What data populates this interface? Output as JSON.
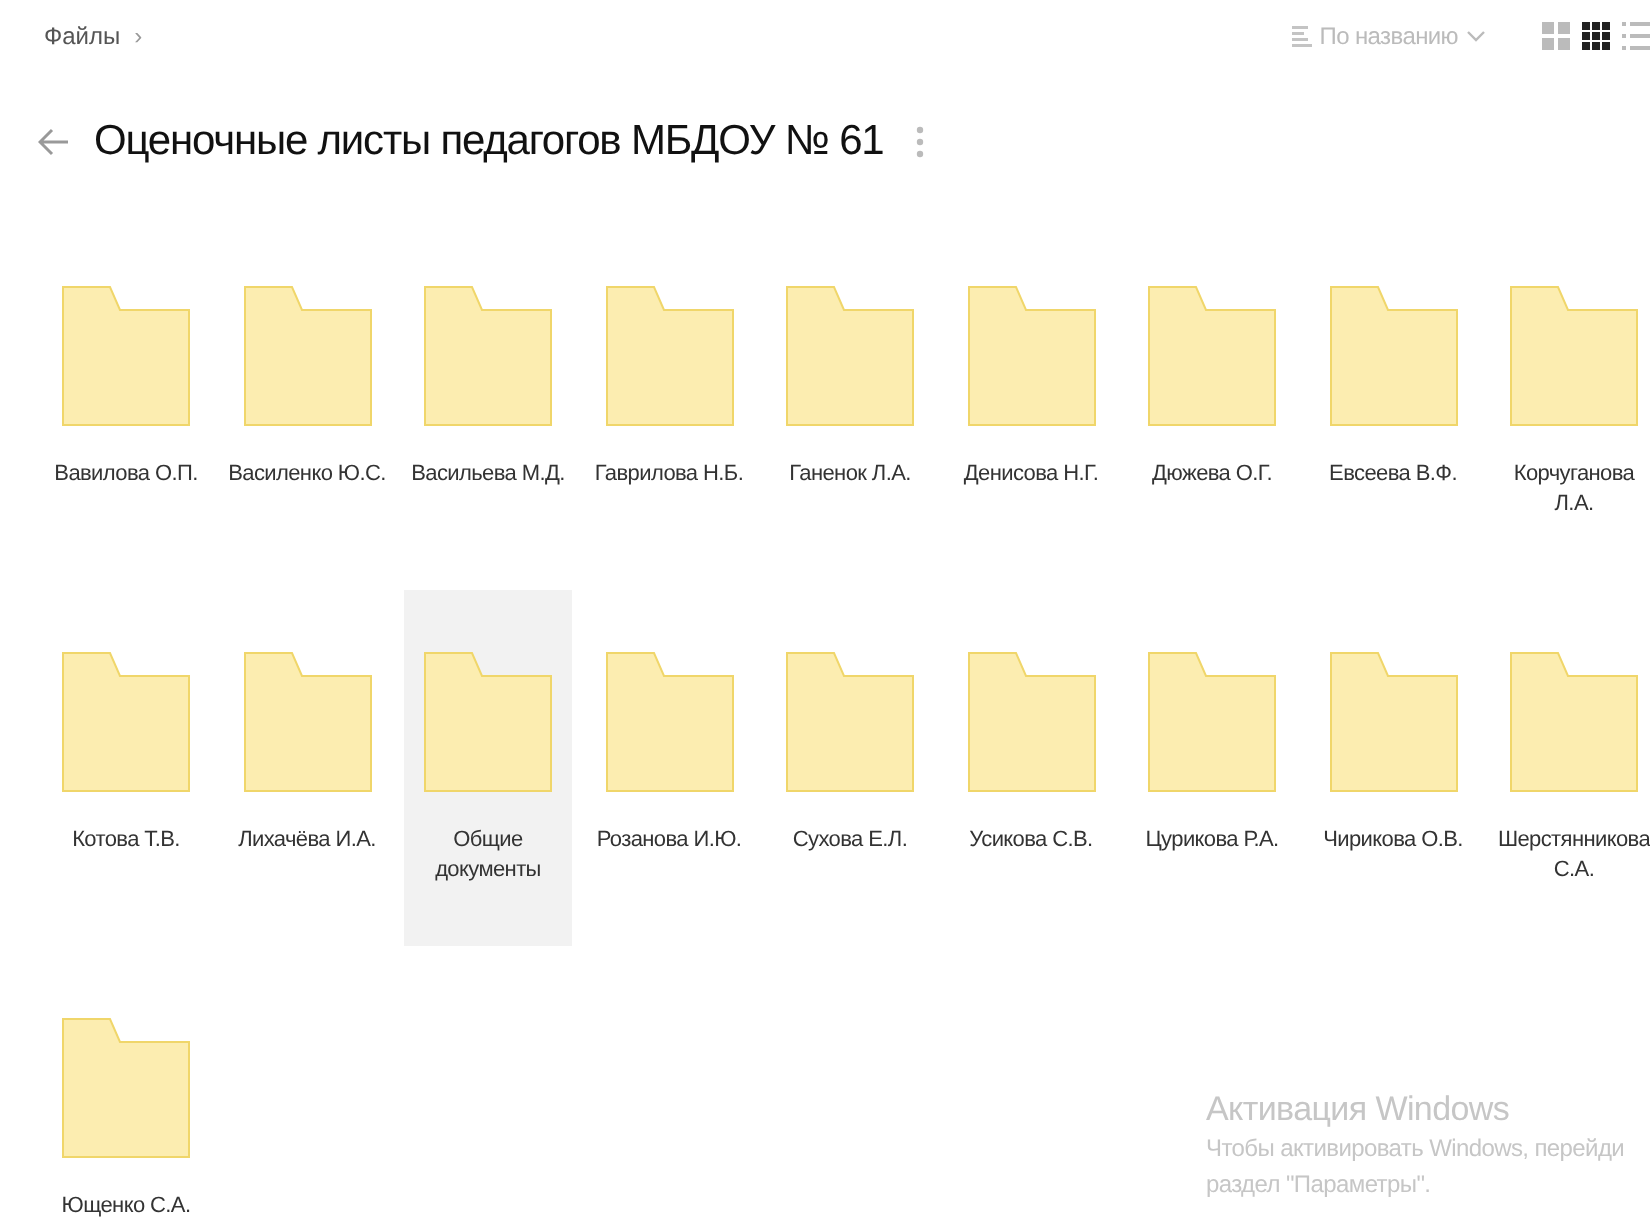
{
  "breadcrumb": {
    "label": "Файлы",
    "separator": "›"
  },
  "sort": {
    "label": "По названию"
  },
  "views": [
    {
      "kind": "large",
      "selected": false
    },
    {
      "kind": "small",
      "selected": true
    },
    {
      "kind": "list",
      "selected": false
    }
  ],
  "title": "Оценочные листы педагогов МБДОУ № 61",
  "folders": [
    {
      "name": "Вавилова О.П.",
      "selected": false
    },
    {
      "name": "Василенко Ю.С.",
      "selected": false
    },
    {
      "name": "Васильева М.Д.",
      "selected": false
    },
    {
      "name": "Гаврилова Н.Б.",
      "selected": false
    },
    {
      "name": "Ганенок Л.А.",
      "selected": false
    },
    {
      "name": "Денисова Н.Г.",
      "selected": false
    },
    {
      "name": "Дюжева О.Г.",
      "selected": false
    },
    {
      "name": "Евсеева В.Ф.",
      "selected": false
    },
    {
      "name": "Корчуганова Л.А.",
      "selected": false
    },
    {
      "name": "Котова Т.В.",
      "selected": false
    },
    {
      "name": "Лихачёва И.А.",
      "selected": false
    },
    {
      "name": "Общие документы",
      "selected": true
    },
    {
      "name": "Розанова И.Ю.",
      "selected": false
    },
    {
      "name": "Сухова Е.Л.",
      "selected": false
    },
    {
      "name": "Усикова С.В.",
      "selected": false
    },
    {
      "name": "Цурикова Р.А.",
      "selected": false
    },
    {
      "name": "Чирикова О.В.",
      "selected": false
    },
    {
      "name": "Шерстянникова С.А.",
      "selected": false
    },
    {
      "name": "Ющенко С.А.",
      "selected": false
    }
  ],
  "windows_activation": {
    "heading": "Активация Windows",
    "lines": [
      "Чтобы активировать Windows, перейди",
      "раздел \"Параметры\"."
    ]
  }
}
